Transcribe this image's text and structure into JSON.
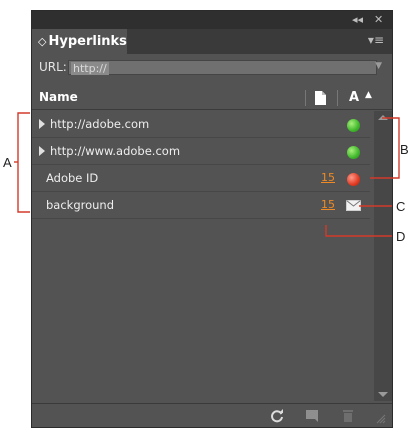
{
  "window": {
    "collapse_glyph": "◂◂",
    "close_glyph": "✕"
  },
  "panel": {
    "tab_glyph": "◇",
    "title": "Hyperlinks",
    "menu_glyph": "▾≡"
  },
  "url": {
    "label": "URL:",
    "value": "http://"
  },
  "columns": {
    "name": "Name",
    "warning_glyph": "A",
    "sort_glyph": "▲"
  },
  "hyperlinks": [
    {
      "name": "http://adobe.com",
      "expandable": true,
      "page": "",
      "status": "ok",
      "status_color": "#3fb72b"
    },
    {
      "name": "http://www.adobe.com",
      "expandable": true,
      "page": "",
      "status": "ok",
      "status_color": "#3fb72b"
    },
    {
      "name": "Adobe ID",
      "expandable": false,
      "page": "15",
      "status": "error",
      "status_color": "#e23a22"
    },
    {
      "name": "background",
      "expandable": false,
      "page": "15",
      "status": "email-icon",
      "status_color": ""
    }
  ],
  "callouts": {
    "a": "A",
    "b": "B",
    "c": "C",
    "d": "D"
  },
  "colors": {
    "panel_bg": "#535353",
    "page_link": "#f08a24",
    "callout": "#d43a2a"
  }
}
